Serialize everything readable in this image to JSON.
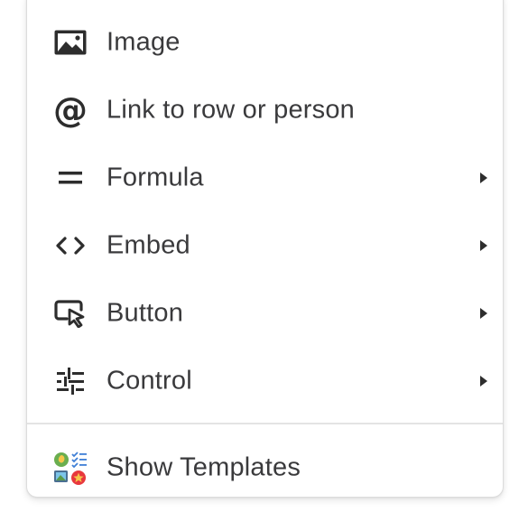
{
  "menu": {
    "items": [
      {
        "label": "Image",
        "icon": "image-icon",
        "submenu": false
      },
      {
        "label": "Link to row or person",
        "icon": "at-sign-icon",
        "submenu": false
      },
      {
        "label": "Formula",
        "icon": "equals-icon",
        "submenu": true
      },
      {
        "label": "Embed",
        "icon": "code-brackets-icon",
        "submenu": true
      },
      {
        "label": "Button",
        "icon": "button-cursor-icon",
        "submenu": true
      },
      {
        "label": "Control",
        "icon": "sliders-icon",
        "submenu": true
      }
    ],
    "footer": {
      "label": "Show Templates",
      "icon": "templates-icon"
    }
  },
  "colors": {
    "icon": "#2d2d2d",
    "text": "#3a3a3c",
    "template_green": "#6aae4f",
    "template_red": "#e8383d",
    "template_blue": "#3f7fd6"
  }
}
